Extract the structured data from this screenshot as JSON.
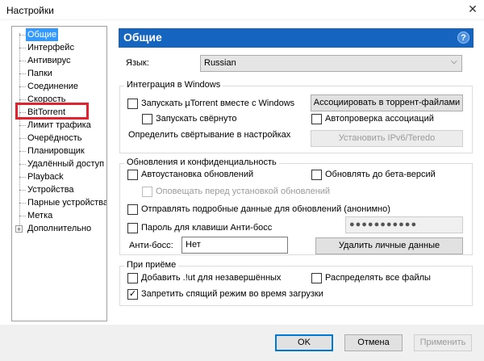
{
  "window": {
    "title": "Настройки",
    "close_glyph": "✕"
  },
  "tree": {
    "items": [
      {
        "label": "Общие",
        "selected": true
      },
      {
        "label": "Интерфейс"
      },
      {
        "label": "Антивирус"
      },
      {
        "label": "Папки"
      },
      {
        "label": "Соединение"
      },
      {
        "label": "Скорость"
      },
      {
        "label": "BitTorrent"
      },
      {
        "label": "Лимит трафика"
      },
      {
        "label": "Очерёдность"
      },
      {
        "label": "Планировщик"
      },
      {
        "label": "Удалённый доступ"
      },
      {
        "label": "Playback"
      },
      {
        "label": "Устройства"
      },
      {
        "label": "Парные устройства"
      },
      {
        "label": "Метка"
      },
      {
        "label": "Дополнительно",
        "expandable": true
      }
    ],
    "expander_glyph": "+",
    "highlight_color": "#e0232e"
  },
  "panel": {
    "title": "Общие",
    "help_glyph": "?",
    "header_color": "#1565c0"
  },
  "language": {
    "label": "Язык:",
    "value": "Russian",
    "chevron": "⌵"
  },
  "windows_integration": {
    "title": "Интеграция в Windows",
    "start_with_windows": "Запускать µTorrent вместе с Windows",
    "start_minimized": "Запускать свёрнуто",
    "tray_label": "Определить свёртывание в настройках",
    "associate_button": "Ассоциировать в торрент-файлами",
    "auto_check_assoc": "Автопроверка ассоциаций",
    "ipv6_button": "Установить IPv6/Teredo"
  },
  "updates": {
    "title": "Обновления и конфиденциальность",
    "auto_install": "Автоустановка обновлений",
    "beta_updates": "Обновлять до бета-версий",
    "notify_before": "Оповещать перед установкой обновлений",
    "send_data": "Отправлять подробные данные для обновлений (анонимно)",
    "boss_password": "Пароль для клавиши Анти-босс",
    "password_value": "●●●●●●●●●●●",
    "boss_key_label": "Анти-босс:",
    "boss_key_value": "Нет",
    "delete_data_button": "Удалить личные данные"
  },
  "on_add": {
    "title": "При приёме",
    "append_ut": "Добавить .!ut для незавершённых",
    "prealloc": "Распределять все файлы",
    "prevent_sleep": "Запретить спящий режим во время загрузки",
    "check_glyph": "✓"
  },
  "footer": {
    "ok": "OK",
    "cancel": "Отмена",
    "apply": "Применить"
  }
}
